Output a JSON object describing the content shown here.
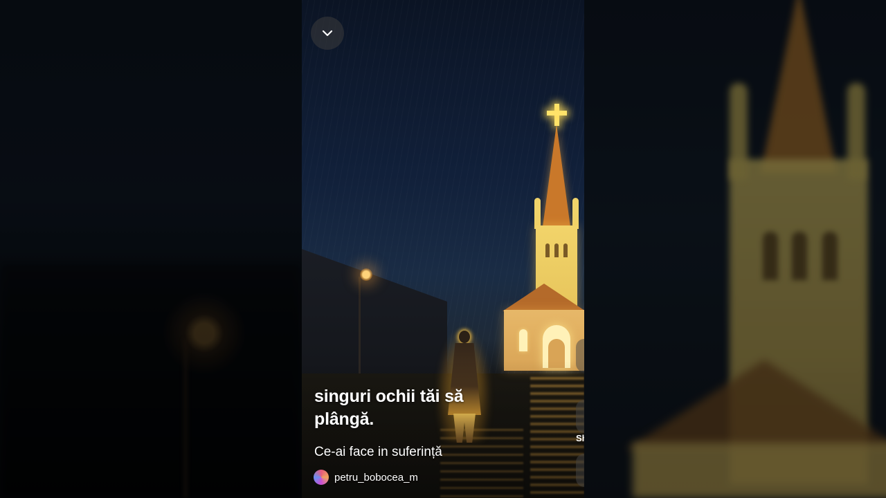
{
  "player": {
    "collapse_icon": "chevron-down-icon",
    "caption_text": "singuri ochii tăi să plângă.",
    "video_title": "Ce-ai face in suferință",
    "channel_name": "petru_bobocea_m",
    "side_action_partial_label": "Sh"
  },
  "colors": {
    "panel_sky": "#11203a",
    "church_glow": "#f2d46a",
    "cross": "#ffe36a",
    "text": "#ffffff"
  }
}
